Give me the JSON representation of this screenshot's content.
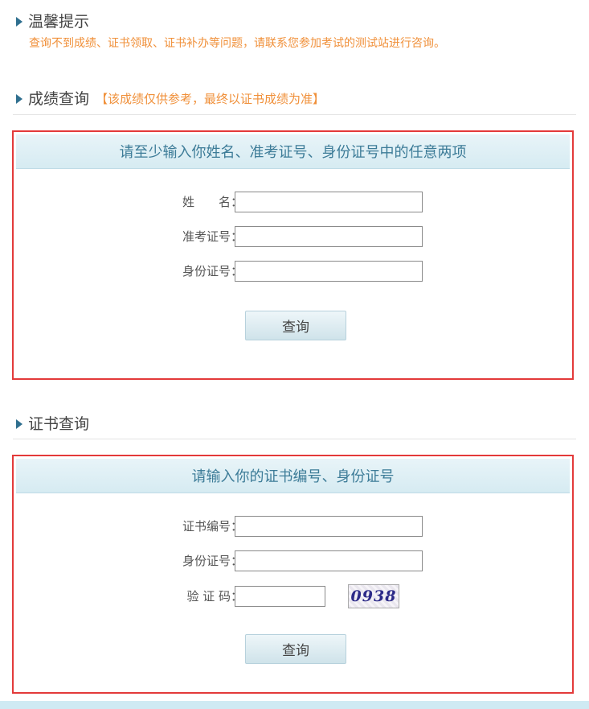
{
  "tip": {
    "title": "温馨提示",
    "text": "查询不到成绩、证书领取、证书补办等问题，请联系您参加考试的测试站进行咨询。"
  },
  "score_query": {
    "title": "成绩查询",
    "note": "【该成绩仅供参考，最终以证书成绩为准】",
    "box_title": "请至少输入你姓名、准考证号、身份证号中的任意两项",
    "name_label": "姓　　名：",
    "ticket_label": "准考证号：",
    "id_label": "身份证号：",
    "name_value": "",
    "ticket_value": "",
    "id_value": "",
    "submit_label": "查询"
  },
  "cert_query": {
    "title": "证书查询",
    "box_title": "请输入你的证书编号、身份证号",
    "cert_label": "证书编号：",
    "id_label": "身份证号：",
    "captcha_label": "验 证 码：",
    "cert_value": "",
    "id_value": "",
    "captcha_value": "",
    "captcha_image_text": "0938",
    "submit_label": "查询"
  },
  "colors": {
    "accent_orange": "#f0903a",
    "highlight_red": "#e33a3a",
    "header_blue": "#3d7c98"
  }
}
